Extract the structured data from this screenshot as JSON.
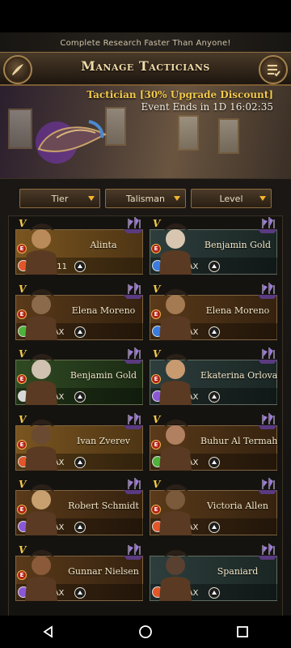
{
  "banner_text": "Complete Research Faster Than Anyone!",
  "title": "Manage Tacticians",
  "event": {
    "line1": "Tactician [30% Upgrade Discount]",
    "line2": "Event Ends in 1D 16:02:35"
  },
  "filters": {
    "tier": "Tier",
    "talisman": "Talisman",
    "level": "Level"
  },
  "tacticians": [
    {
      "name": "Alinta",
      "level": "SLv.1-11",
      "rank": "V",
      "tier_badge": "E",
      "gem_color": "#e2562a",
      "panel": "gold"
    },
    {
      "name": "Benjamin Gold",
      "level": "Lv. MAX",
      "rank": "V",
      "tier_badge": "E",
      "gem_color": "#3a7be0",
      "panel": "teal"
    },
    {
      "name": "Elena Moreno",
      "level": "Lv. MAX",
      "rank": "V",
      "tier_badge": "E",
      "gem_color": "#4fb23a",
      "panel": "brown"
    },
    {
      "name": "Elena Moreno",
      "level": "Lv. MAX",
      "rank": "V",
      "tier_badge": "E",
      "gem_color": "#3a7be0",
      "panel": "brown"
    },
    {
      "name": "Benjamin Gold",
      "level": "Lv. MAX",
      "rank": "V",
      "tier_badge": "E",
      "gem_color": "#d8d8d8",
      "panel": "green"
    },
    {
      "name": "Ekaterina Orlova",
      "level": "Lv. MAX",
      "rank": "V",
      "tier_badge": "E",
      "gem_color": "#8a58d6",
      "panel": "teal"
    },
    {
      "name": "Ivan Zverev",
      "level": "Lv. MAX",
      "rank": "V",
      "tier_badge": "E",
      "gem_color": "#e2562a",
      "panel": "gold"
    },
    {
      "name": "Buhur Al Termah",
      "level": "Lv. MAX",
      "rank": "V",
      "tier_badge": "E",
      "gem_color": "#4fb23a",
      "panel": "brown"
    },
    {
      "name": "Robert Schmidt",
      "level": "Lv. MAX",
      "rank": "V",
      "tier_badge": "E",
      "gem_color": "#8a58d6",
      "panel": "brown"
    },
    {
      "name": "Victoria Allen",
      "level": "Lv. MAX",
      "rank": "V",
      "tier_badge": "E",
      "gem_color": "#e2562a",
      "panel": "brown"
    },
    {
      "name": "Gunnar Nielsen",
      "level": "Lv. MAX",
      "rank": "V",
      "tier_badge": "E",
      "gem_color": "#8a58d6",
      "panel": "brown"
    },
    {
      "name": "Spaniard",
      "level": "Lv. MAX",
      "rank": "",
      "tier_badge": "",
      "gem_color": "#e2562a",
      "panel": "teal"
    }
  ],
  "colors": {
    "accent_gold": "#f2c94c",
    "frame_border": "#8f6d40"
  }
}
